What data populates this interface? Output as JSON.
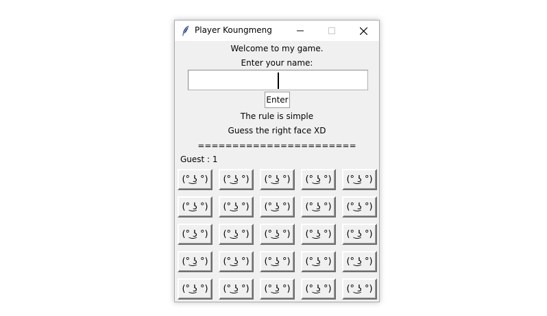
{
  "window": {
    "title": "Player Koungmeng"
  },
  "content": {
    "welcome": "Welcome to my game.",
    "name_prompt": "Enter your name:",
    "name_value": "",
    "enter_label": "Enter",
    "rule_line": "The rule is simple",
    "goal_line": "Guess the right face XD",
    "separator": "=======================",
    "guest_label": "Guest : 1"
  },
  "face_grid": {
    "rows": 5,
    "cols": 5,
    "labels": [
      "(° ͜ʖ °)",
      "(° ͜ʖ °)",
      "(° ͜ʖ °)",
      "(° ͜ʖ °)",
      "(° ͜ʖ °)",
      "(° ͜ʖ °)",
      "(° ͜ʖ °)",
      "(° ͜ʖ °)",
      "(° ͜ʖ °)",
      "(° ͜ʖ °)",
      "(° ͜ʖ °)",
      "(° ͜ʖ °)",
      "(° ͜ʖ °)",
      "(° ͜ʖ °)",
      "(° ͜ʖ °)",
      "(° ͜ʖ °)",
      "(° ͜ʖ °)",
      "(° ͜ʖ °)",
      "(° ͜ʖ °)",
      "(° ͜ʖ °)",
      "(° ͜ʖ °)",
      "(° ͜ʖ °)",
      "(° ͜ʖ °)",
      "(° ͜ʖ °)",
      "(° ͜ʖ °)"
    ]
  },
  "icons": {
    "app": "feather-icon",
    "minimize": "minimize-icon",
    "maximize": "maximize-icon",
    "close": "close-icon"
  },
  "colors": {
    "window_bg": "#f0f0f0",
    "titlebar_bg": "#ffffff",
    "entry_bg": "#ffffff",
    "text": "#000000"
  }
}
